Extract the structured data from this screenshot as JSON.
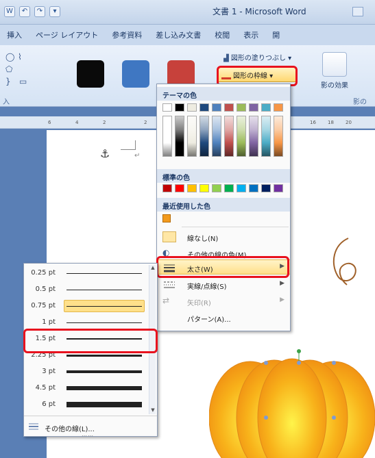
{
  "window": {
    "title": "文書 1 - Microsoft Word"
  },
  "tabs": [
    "挿入",
    "ページ レイアウト",
    "参考資料",
    "差し込み文書",
    "校閲",
    "表示",
    "開"
  ],
  "ribbon": {
    "fill_command": "図形の塗りつぶし",
    "outline_command": "図形の枠線",
    "effect_label": "影の効果",
    "group_label_left": "入",
    "group_label_right": "影の",
    "style_colors": [
      "#0a0a0a",
      "#3f77c2",
      "#c7413b"
    ]
  },
  "ruler": {
    "ticks": [
      "6",
      "4",
      "2",
      "2",
      "16",
      "18",
      "20"
    ]
  },
  "outline_menu": {
    "theme_colors_header": "テーマの色",
    "standard_colors_header": "標準の色",
    "recent_colors_header": "最近使用した色",
    "theme_top_row": [
      "#ffffff",
      "#000000",
      "#eeece1",
      "#1f497d",
      "#4f81bd",
      "#c0504d",
      "#9bbb59",
      "#8064a2",
      "#4bacc6",
      "#f79646"
    ],
    "standard_colors": [
      "#c00000",
      "#ff0000",
      "#ffc000",
      "#ffff00",
      "#92d050",
      "#00b050",
      "#00b0f0",
      "#0070c0",
      "#002060",
      "#7030a0"
    ],
    "recent_color": "#f29a1d",
    "items": [
      {
        "label": "線なし(N)"
      },
      {
        "label": "その他の線の色(M)..."
      },
      {
        "label": "太さ(W)"
      },
      {
        "label": "実線/点線(S)"
      },
      {
        "label": "矢印(R)"
      },
      {
        "label": "パターン(A)..."
      }
    ]
  },
  "weight_menu": {
    "items": [
      {
        "label": "0.25 pt",
        "weight": 0.25
      },
      {
        "label": "0.5 pt",
        "weight": 0.5
      },
      {
        "label": "0.75 pt",
        "weight": 0.75
      },
      {
        "label": "1 pt",
        "weight": 1
      },
      {
        "label": "1.5 pt",
        "weight": 1.5
      },
      {
        "label": "2.25 pt",
        "weight": 2.25
      },
      {
        "label": "3 pt",
        "weight": 3
      },
      {
        "label": "4.5 pt",
        "weight": 4.5
      },
      {
        "label": "6 pt",
        "weight": 6
      }
    ],
    "more_lines": "その他の線(L)...",
    "selected": "0.75 pt",
    "highlighted": "1.5 pt"
  },
  "colors": {
    "highlight_border": "#e8121e",
    "hover_fill": "#ffe08a",
    "pumpkin": "#f8a21a"
  }
}
